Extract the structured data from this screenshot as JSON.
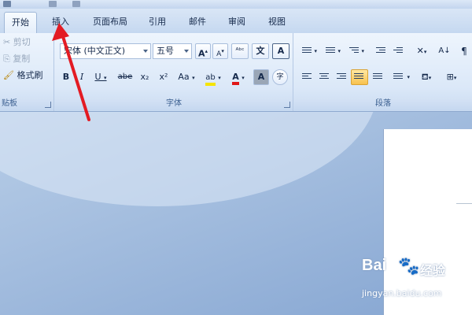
{
  "tabs": [
    {
      "label": "开始",
      "active": true
    },
    {
      "label": "插入",
      "active": false
    },
    {
      "label": "页面布局",
      "active": false
    },
    {
      "label": "引用",
      "active": false
    },
    {
      "label": "邮件",
      "active": false
    },
    {
      "label": "审阅",
      "active": false
    },
    {
      "label": "视图",
      "active": false
    }
  ],
  "clipboard": {
    "cut_label": "剪切",
    "copy_label": "复制",
    "format_painter_label": "格式刷",
    "group_label": "贴板"
  },
  "font": {
    "font_name": "宋体 (中文正文)",
    "font_size": "五号",
    "grow_glyph": "A",
    "shrink_glyph": "A",
    "phonetic_glyph": "文",
    "char_border_glyph": "A",
    "bold_glyph": "B",
    "italic_glyph": "I",
    "underline_glyph": "U",
    "strike_glyph": "abe",
    "subscript_glyph": "x₂",
    "superscript_glyph": "x²",
    "change_case_glyph": "Aa",
    "highlight_glyph": "ab",
    "font_color_glyph": "A",
    "char_shading_glyph": "A",
    "enclose_glyph": "字",
    "group_label": "字体",
    "highlight_color": "#f5e400",
    "font_color_bar": "#e01818"
  },
  "paragraph": {
    "group_label": "段落"
  },
  "watermark": {
    "brand": "Bai",
    "paw": "🐾",
    "name": "经验",
    "url": "jingyan.baidu.com"
  },
  "colors": {
    "annotation_arrow": "#e31b23"
  }
}
